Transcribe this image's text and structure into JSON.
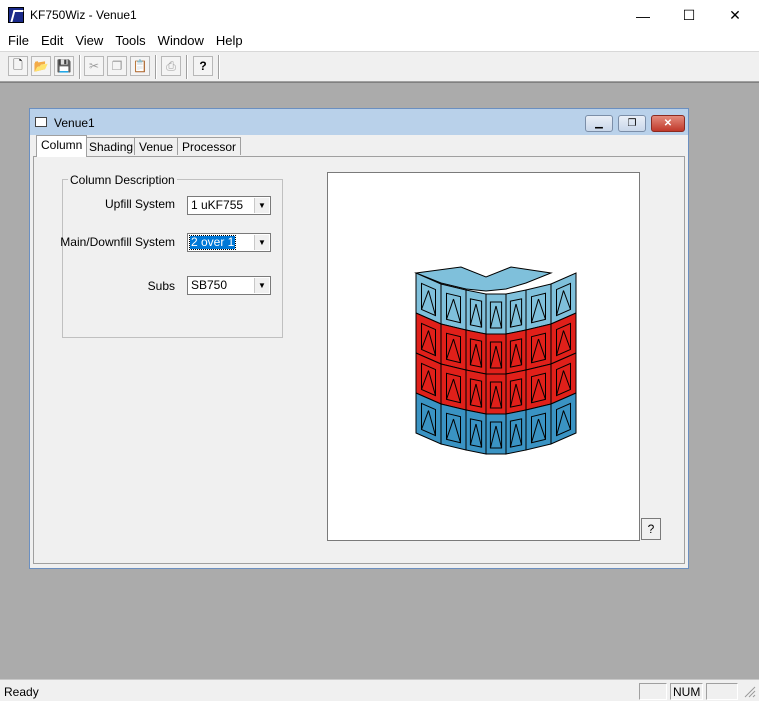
{
  "window": {
    "title": "KF750Wiz - Venue1",
    "icon": "app-icon",
    "min_glyph": "—",
    "max_glyph": "☐",
    "close_glyph": "✕"
  },
  "menu": [
    "File",
    "Edit",
    "View",
    "Tools",
    "Window",
    "Help"
  ],
  "toolbar": [
    {
      "icon": "new-file-icon",
      "glyph": "🗋",
      "enabled": true
    },
    {
      "icon": "open-folder-icon",
      "glyph": "📂",
      "enabled": true
    },
    {
      "icon": "save-icon",
      "glyph": "💾",
      "enabled": true
    },
    {
      "icon": "cut-icon",
      "glyph": "✂",
      "enabled": false
    },
    {
      "icon": "copy-icon",
      "glyph": "❐",
      "enabled": false
    },
    {
      "icon": "paste-icon",
      "glyph": "📋",
      "enabled": false
    },
    {
      "icon": "print-icon",
      "glyph": "⎙",
      "enabled": false
    },
    {
      "icon": "help-icon",
      "glyph": "?",
      "enabled": true
    }
  ],
  "child": {
    "title": "Venue1",
    "tabs": [
      "Column",
      "Shading",
      "Venue",
      "Processor"
    ],
    "active_tab": "Column",
    "group_title": "Column Description",
    "fields": [
      {
        "label": "Upfill System",
        "value": "1 uKF755"
      },
      {
        "label": "Main/Downfill System",
        "value": "2 over 1",
        "selected": true
      },
      {
        "label": "Subs",
        "value": "SB750"
      }
    ],
    "help_button": "?"
  },
  "preview_colors": {
    "top": "#7fc0db",
    "middle": "#e0201a",
    "bottom": "#3a93c3",
    "stroke": "#000000"
  },
  "status": {
    "text": "Ready",
    "panes": [
      "",
      "NUM",
      ""
    ]
  }
}
